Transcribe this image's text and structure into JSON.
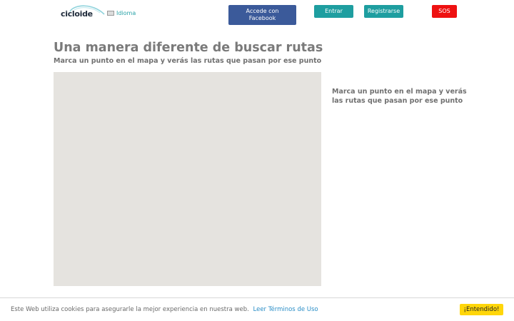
{
  "header": {
    "logo_text": "cicloide",
    "language_label": "Idioma",
    "facebook_button": "Accede con Facebook",
    "login_button": "Entrar",
    "register_button": "Registrarse",
    "sos_button": "SOS"
  },
  "main": {
    "title": "Una manera diferente de buscar rutas",
    "subtitle": "Marca un punto en el mapa y verás las rutas que pasan por ese punto",
    "side_text": "Marca un punto en el mapa y verás las rutas que pasan por ese punto"
  },
  "cookie_bar": {
    "text": "Este Web utiliza cookies para asegurarle la mejor experiencia en nuestra web.",
    "link_text": "Leer Términos de Uso",
    "accept_button": "¡Entendido!"
  },
  "colors": {
    "facebook": "#3b5a9a",
    "teal": "#1e9ea0",
    "sos": "#ee1111",
    "cookie_button": "#ffd60a",
    "map_background": "#e5e3df"
  },
  "icons": [
    "logo-swoosh-icon",
    "flag-icon"
  ]
}
